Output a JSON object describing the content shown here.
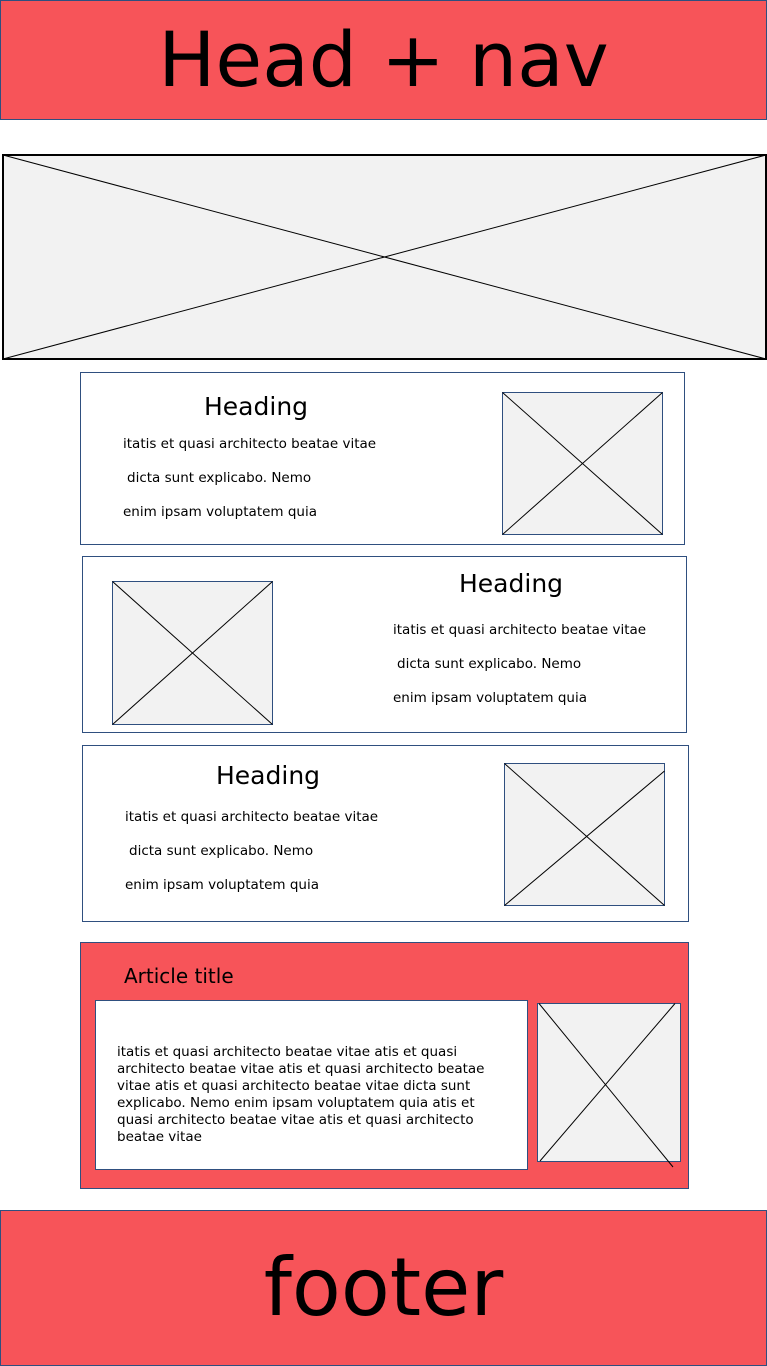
{
  "header": {
    "label": "Head + nav"
  },
  "sections": [
    {
      "heading": "Heading",
      "lines": [
        "itatis et quasi architecto beatae vitae",
        "dicta sunt explicabo. Nemo",
        "enim ipsam voluptatem quia"
      ]
    },
    {
      "heading": "Heading",
      "lines": [
        "itatis et quasi architecto beatae vitae",
        "dicta sunt explicabo. Nemo",
        "enim ipsam voluptatem quia"
      ]
    },
    {
      "heading": "Heading",
      "lines": [
        "itatis et quasi architecto beatae vitae",
        "dicta sunt explicabo. Nemo",
        "enim ipsam voluptatem quia"
      ]
    }
  ],
  "article": {
    "title": "Article title",
    "text": "itatis et quasi architecto beatae vitae atis et quasi architecto beatae vitae atis et quasi architecto beatae vitae atis et quasi architecto beatae vitae dicta sunt explicabo. Nemo  enim ipsam voluptatem quia atis et quasi architecto beatae vitae atis et quasi architecto beatae vitae"
  },
  "footer": {
    "label": "footer"
  },
  "colors": {
    "accent": "#f75459",
    "placeholder_fill": "#f2f2f2",
    "border": "#2f4f7f"
  }
}
